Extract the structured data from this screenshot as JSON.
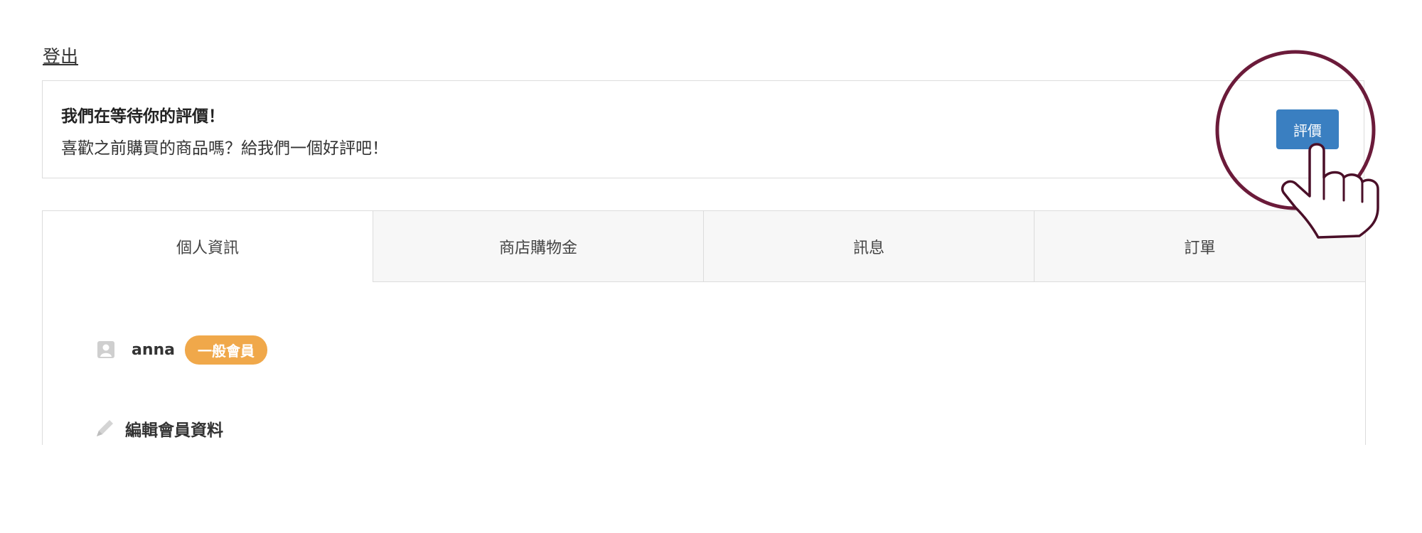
{
  "header": {
    "logout_label": "登出"
  },
  "review_banner": {
    "title": "我們在等待你的評價！",
    "subtitle": "喜歡之前購買的商品嗎？給我們一個好評吧！",
    "button_label": "評價"
  },
  "tabs": [
    {
      "label": "個人資訊",
      "active": true
    },
    {
      "label": "商店購物金",
      "active": false
    },
    {
      "label": "訊息",
      "active": false
    },
    {
      "label": "訂單",
      "active": false
    }
  ],
  "profile": {
    "username": "anna",
    "member_badge": "一般會員",
    "edit_label": "編輯會員資料",
    "user_icon": "user-card-icon",
    "edit_icon": "pencil-icon"
  },
  "colors": {
    "button": "#3a7fc1",
    "badge": "#f0a84a",
    "highlight_circle": "#6b1b3a"
  }
}
